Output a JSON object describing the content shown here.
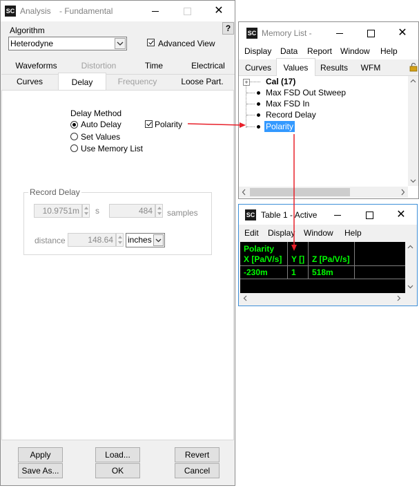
{
  "analysis": {
    "logo": "SC",
    "title": "Analysis",
    "subtitle": "- Fundamental",
    "help_label": "?",
    "algorithm_label": "Algorithm",
    "algorithm_value": "Heterodyne",
    "advanced_view_label": "Advanced View",
    "tabs_row1": [
      "Waveforms",
      "Distortion",
      "Time",
      "Electrical"
    ],
    "tabs_row2": [
      "Curves",
      "Delay",
      "Frequency",
      "Loose Part."
    ],
    "delay_method_label": "Delay Method",
    "options": [
      "Auto Delay",
      "Set Values",
      "Use Memory List"
    ],
    "selected_option": "Auto Delay",
    "polarity_label": "Polarity",
    "record_delay_label": "Record Delay",
    "delay_value": "10.9751m",
    "delay_unit": "s",
    "samples_value": "484",
    "samples_unit": "samples",
    "distance_label": "distance",
    "distance_value": "148.64",
    "distance_unit": "inches",
    "buttons": {
      "apply": "Apply",
      "load": "Load...",
      "revert": "Revert",
      "save_as": "Save As...",
      "ok": "OK",
      "cancel": "Cancel"
    }
  },
  "memory": {
    "logo": "SC",
    "title": "Memory List -",
    "menu": [
      "Display",
      "Data",
      "Report",
      "Window",
      "Help"
    ],
    "tabs": [
      "Curves",
      "Values",
      "Results",
      "WFM"
    ],
    "active_tab": "Values",
    "root": "Cal (17)",
    "items": [
      "Max FSD Out Stweep",
      "Max FSD In",
      "Record Delay",
      "Polarity"
    ],
    "selected_item": "Polarity"
  },
  "table": {
    "logo": "SC",
    "title": "Table 1 - Active",
    "menu": [
      "Edit",
      "Display",
      "Window",
      "Help"
    ],
    "header_title": "Polarity",
    "columns": [
      "X [Pa/V/s]",
      "Y []",
      "Z [Pa/V/s]"
    ],
    "rows": [
      [
        "-230m",
        "1",
        "518m"
      ]
    ],
    "colors": {
      "background": "#000000",
      "text": "#00ff00"
    }
  },
  "colors": {
    "arrow": "#e8202a",
    "selection": "#3399ff"
  }
}
